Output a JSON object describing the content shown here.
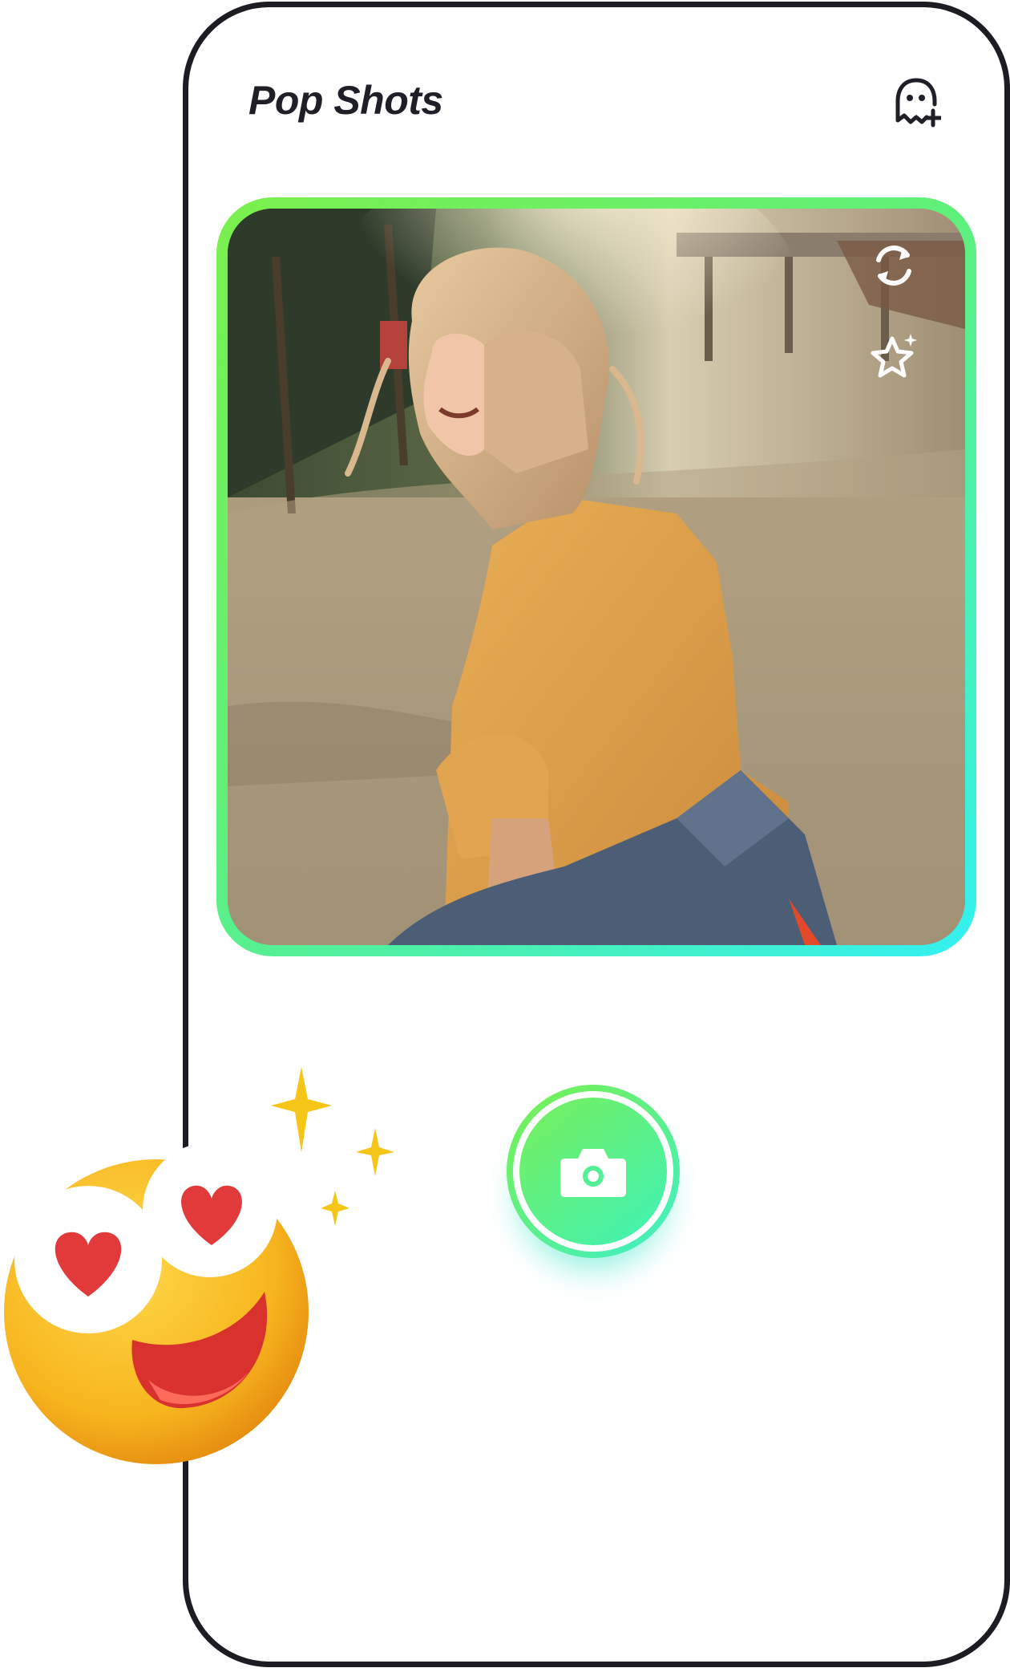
{
  "header": {
    "app_title": "Pop Shots",
    "profile_icon": "ghost-plus-icon"
  },
  "preview": {
    "image": "woman-in-yellow-shirt-photo",
    "overlay_actions": [
      {
        "icon": "refresh-icon"
      },
      {
        "icon": "sparkle-star-icon"
      }
    ]
  },
  "capture": {
    "icon": "camera-icon"
  },
  "decorations": {
    "sticker": "heart-eyes-emoji",
    "sparkles": "sparkle-icon"
  },
  "colors": {
    "accent_green": "#7bf04d",
    "accent_cyan": "#33f0f2",
    "title_text": "#1f1f27",
    "phone_border": "#1c1c22"
  }
}
